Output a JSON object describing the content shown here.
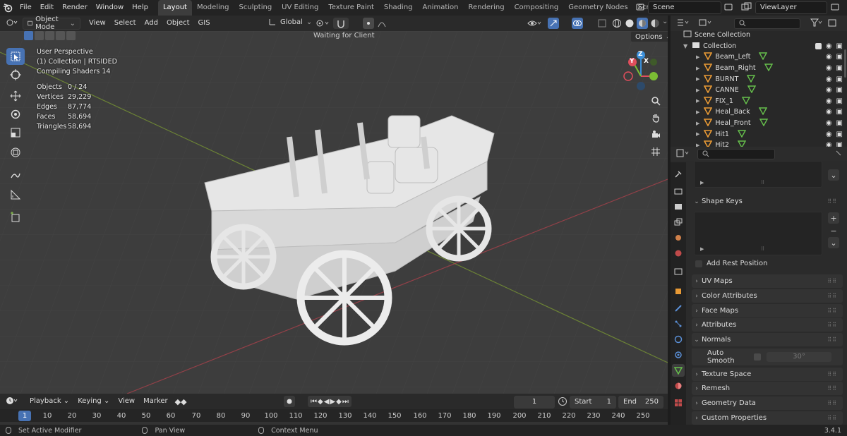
{
  "topbar": {
    "menu": [
      "File",
      "Edit",
      "Render",
      "Window",
      "Help"
    ],
    "workspaces": [
      "Layout",
      "Modeling",
      "Sculpting",
      "UV Editing",
      "Texture Paint",
      "Shading",
      "Animation",
      "Rendering",
      "Compositing",
      "Geometry Nodes",
      "Scripting"
    ],
    "add_tab": "+",
    "scene": "Scene",
    "view_layer": "ViewLayer"
  },
  "header3d": {
    "mode": "Object Mode",
    "menus": [
      "View",
      "Select",
      "Add",
      "Object",
      "GIS"
    ],
    "orientation": "Global",
    "status": "Waiting for Client",
    "options": "Options"
  },
  "viewport": {
    "info": [
      "User Perspective",
      "(1) Collection | RTSIDED",
      "Compiling Shaders 14"
    ],
    "stats": [
      {
        "label": "Objects",
        "value": "0 / 24"
      },
      {
        "label": "Vertices",
        "value": "29,229"
      },
      {
        "label": "Edges",
        "value": "87,774"
      },
      {
        "label": "Faces",
        "value": "58,694"
      },
      {
        "label": "Triangles",
        "value": "58,694"
      }
    ],
    "gizmo": {
      "x": "X",
      "y": "Y",
      "z": "Z"
    }
  },
  "timeline": {
    "menus": [
      "Playback",
      "Keying",
      "View",
      "Marker"
    ],
    "current_frame": "1",
    "start_label": "Start",
    "start": "1",
    "end_label": "End",
    "end": "250",
    "ticks": [
      "1",
      "10",
      "20",
      "30",
      "40",
      "50",
      "60",
      "70",
      "80",
      "90",
      "100",
      "110",
      "120",
      "130",
      "140",
      "150",
      "160",
      "170",
      "180",
      "190",
      "200",
      "210",
      "220",
      "230",
      "240",
      "250"
    ]
  },
  "statusbar": {
    "items": [
      "Set Active Modifier",
      "Pan View",
      "Context Menu"
    ],
    "version": "3.4.1"
  },
  "outliner": {
    "root": "Scene Collection",
    "collection": "Collection",
    "objects": [
      "Beam_Left",
      "Beam_Right",
      "BURNT",
      "CANNE",
      "FIX_1",
      "Heal_Back",
      "Heal_Front",
      "Hit1",
      "Hit2"
    ]
  },
  "properties": {
    "shape_keys": "Shape Keys",
    "add_rest_position": "Add Rest Position",
    "panels": [
      "UV Maps",
      "Color Attributes",
      "Face Maps",
      "Attributes"
    ],
    "normals": "Normals",
    "auto_smooth": "Auto Smooth",
    "auto_smooth_angle": "30°",
    "panels_after": [
      "Texture Space",
      "Remesh",
      "Geometry Data",
      "Custom Properties"
    ],
    "plus": "+",
    "minus": "−",
    "chevron": "⌄"
  },
  "colors": {
    "accent": "#4772b3",
    "x_axis": "#e04e5c",
    "y_axis": "#7bbd34",
    "z_axis": "#3b8fd9",
    "orange": "#e99a35",
    "green": "#67c14c"
  }
}
